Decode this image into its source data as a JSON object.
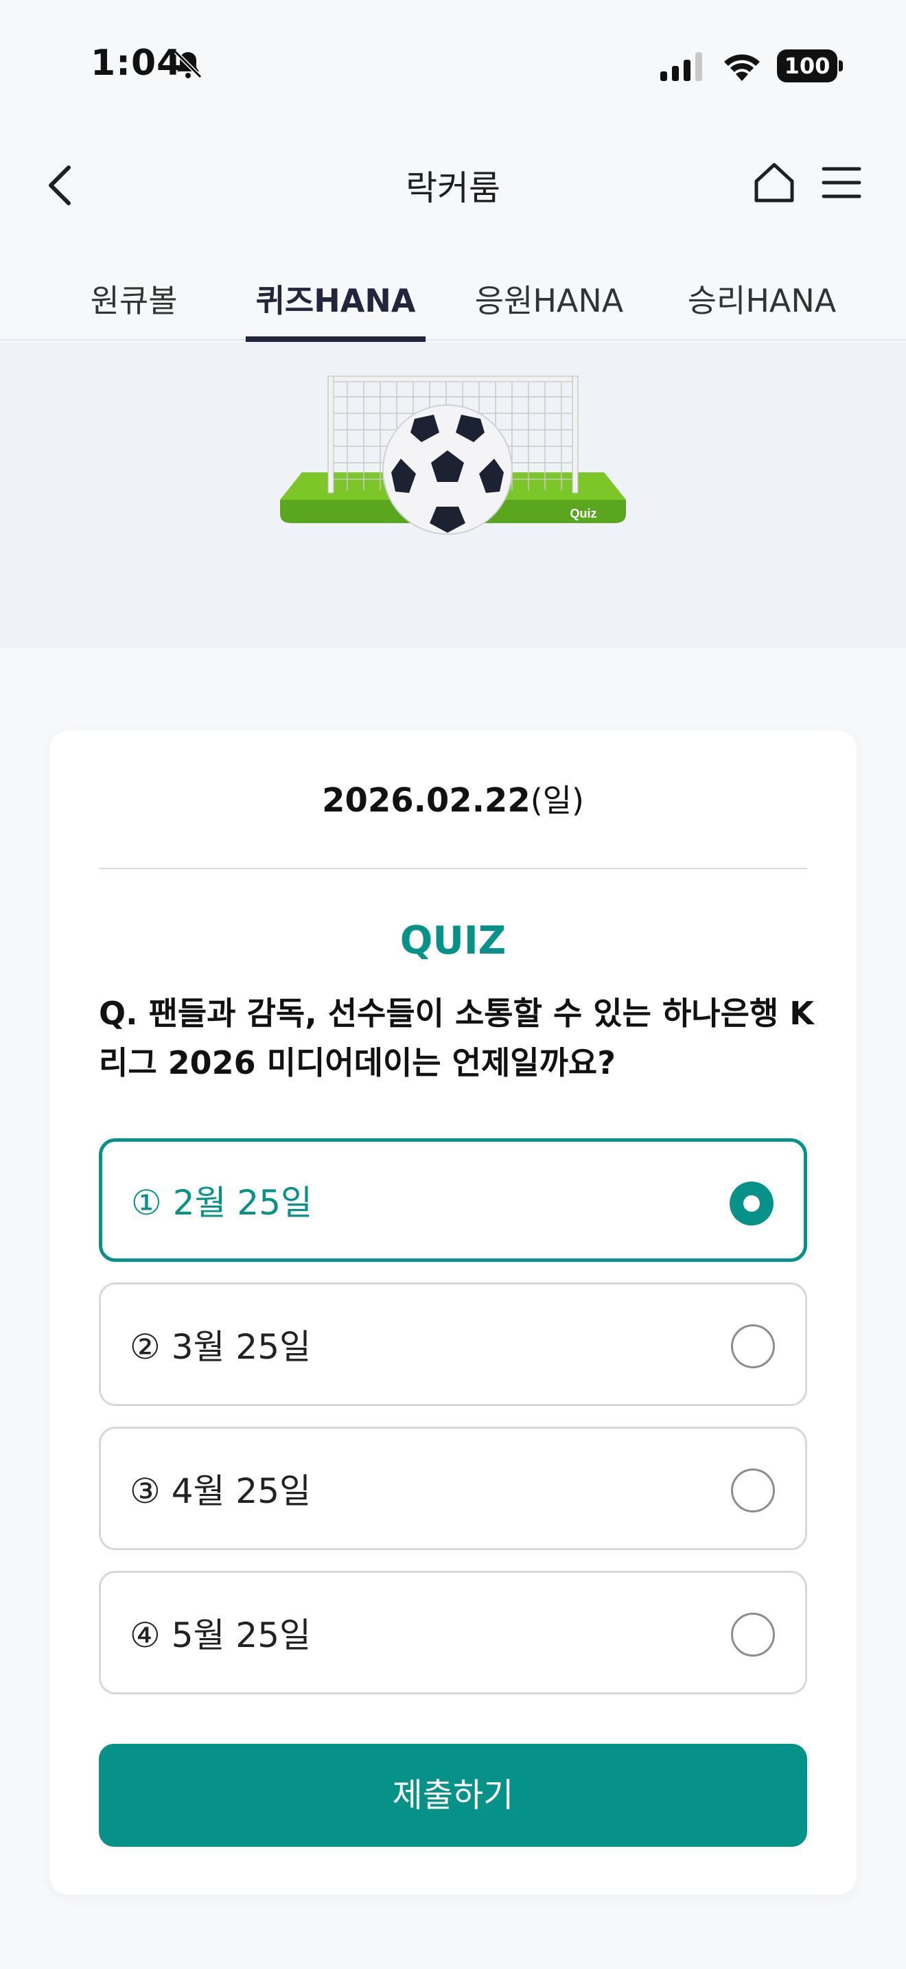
{
  "status_bar": {
    "time": "1:04",
    "battery": "100"
  },
  "header": {
    "title": "락커룸"
  },
  "tabs": [
    {
      "label": "원큐볼",
      "active": false
    },
    {
      "label": "퀴즈HANA",
      "active": true
    },
    {
      "label": "응원HANA",
      "active": false
    },
    {
      "label": "승리HANA",
      "active": false
    }
  ],
  "banner": {
    "net_label": "Quiz"
  },
  "quiz": {
    "date": "2026.02.22",
    "day": "(일)",
    "heading": "QUIZ",
    "question": "Q. 팬들과 감독, 선수들이 소통할 수 있는 하나은행 K리그 2026 미디어데이는 언제일까요?",
    "options": [
      {
        "label": "① 2월 25일",
        "selected": true
      },
      {
        "label": "② 3월 25일",
        "selected": false
      },
      {
        "label": "③ 4월 25일",
        "selected": false
      },
      {
        "label": "④ 5월 25일",
        "selected": false
      }
    ],
    "submit_label": "제출하기"
  },
  "colors": {
    "accent": "#079289",
    "tab_active": "#22253b",
    "banner_bg": "#eff2f6"
  }
}
